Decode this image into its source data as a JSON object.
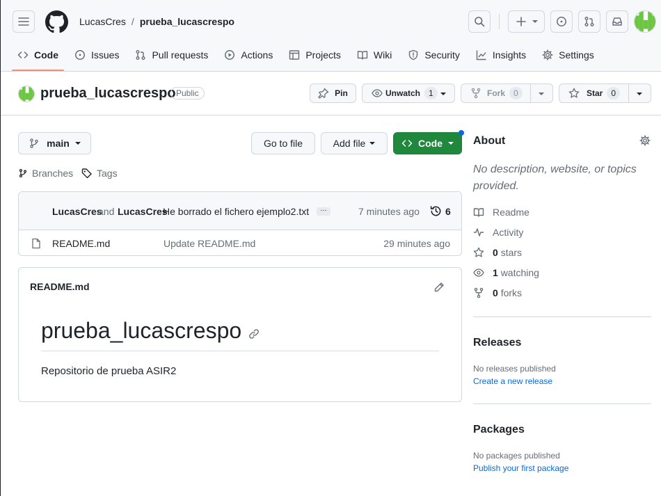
{
  "header": {
    "breadcrumb_owner": "LucasCres",
    "breadcrumb_sep": "/",
    "breadcrumb_repo": "prueba_lucascrespo"
  },
  "tabs": [
    {
      "label": "Code",
      "icon": "code-icon"
    },
    {
      "label": "Issues",
      "icon": "issue-icon"
    },
    {
      "label": "Pull requests",
      "icon": "pull-request-icon"
    },
    {
      "label": "Actions",
      "icon": "play-icon"
    },
    {
      "label": "Projects",
      "icon": "table-icon"
    },
    {
      "label": "Wiki",
      "icon": "book-icon"
    },
    {
      "label": "Security",
      "icon": "shield-icon"
    },
    {
      "label": "Insights",
      "icon": "graph-icon"
    },
    {
      "label": "Settings",
      "icon": "gear-icon"
    }
  ],
  "repo": {
    "title": "prueba_lucascrespo",
    "visibility": "Public",
    "pin_label": "Pin",
    "unwatch_label": "Unwatch",
    "watch_count": "1",
    "fork_label": "Fork",
    "fork_count": "0",
    "star_label": "Star",
    "star_count": "0"
  },
  "toolbar": {
    "branch": "main",
    "go_to_file": "Go to file",
    "add_file": "Add file",
    "code": "Code",
    "branches": "Branches",
    "tags": "Tags"
  },
  "commit": {
    "author1": "LucasCres",
    "and": "and",
    "author2": "LucasCres",
    "message": "He borrado el fichero ejemplo2.txt",
    "ellipsis": "…",
    "time": "7 minutes ago",
    "count": "6"
  },
  "files": [
    {
      "name": "README.md",
      "message": "Update README.md",
      "time": "29 minutes ago"
    }
  ],
  "readme": {
    "filename": "README.md",
    "heading": "prueba_lucascrespo",
    "body": "Repositorio de prueba ASIR2"
  },
  "about": {
    "title": "About",
    "description": "No description, website, or topics provided.",
    "readme": "Readme",
    "activity": "Activity",
    "stars_count": "0",
    "stars_label": "stars",
    "watching_count": "1",
    "watching_label": "watching",
    "forks_count": "0",
    "forks_label": "forks"
  },
  "releases": {
    "title": "Releases",
    "empty": "No releases published",
    "link": "Create a new release"
  },
  "packages": {
    "title": "Packages",
    "empty": "No packages published",
    "link": "Publish your first package"
  },
  "colors": {
    "accent_green": "#1f883d",
    "link_blue": "#0969da",
    "active_tab_underline": "#fd8c73"
  }
}
